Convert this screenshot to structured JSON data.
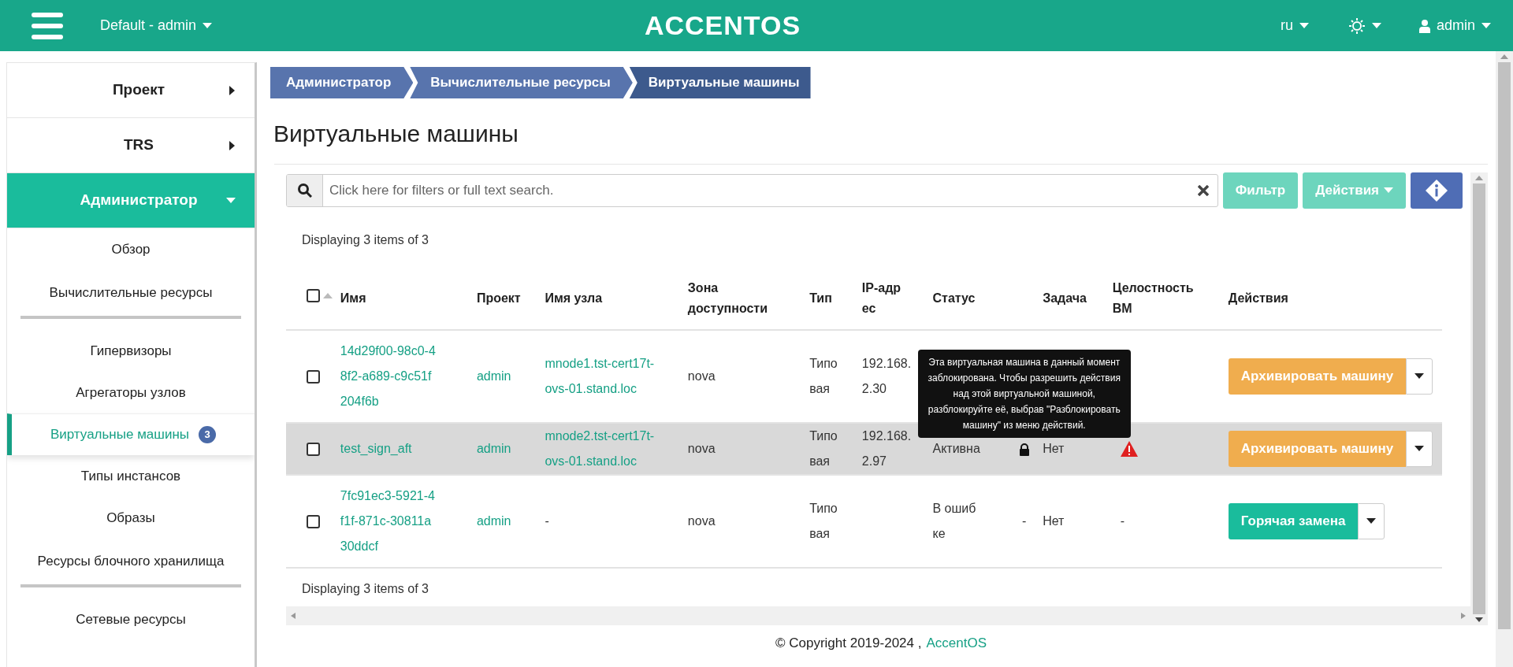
{
  "header": {
    "project_menu": "Default - admin",
    "logo": "ACCENTOS",
    "language": "ru",
    "user": "admin"
  },
  "sidebar": {
    "sections": [
      {
        "label": "Проект",
        "expanded": false
      },
      {
        "label": "TRS",
        "expanded": false
      },
      {
        "label": "Администратор",
        "expanded": true,
        "children": [
          {
            "label": "Обзор",
            "kind": "link",
            "selected": false
          },
          {
            "label": "Вычислительные ресурсы",
            "kind": "group"
          },
          {
            "label": "Гипервизоры",
            "kind": "link",
            "selected": false
          },
          {
            "label": "Агрегаторы узлов",
            "kind": "link",
            "selected": false
          },
          {
            "label": "Виртуальные машины",
            "kind": "link",
            "selected": true,
            "badge": "3"
          },
          {
            "label": "Типы инстансов",
            "kind": "link",
            "selected": false
          },
          {
            "label": "Образы",
            "kind": "link",
            "selected": false
          },
          {
            "label": "Ресурсы блочного хранилища",
            "kind": "group"
          },
          {
            "label": "Сетевые ресурсы",
            "kind": "link",
            "selected": false
          }
        ]
      }
    ]
  },
  "breadcrumb": [
    "Администратор",
    "Вычислительные ресурсы",
    "Виртуальные машины"
  ],
  "title": "Виртуальные машины",
  "search": {
    "placeholder": "Click here for filters or full text search."
  },
  "toolbar": {
    "filter": "Фильтр",
    "actions": "Действия"
  },
  "summary_top": "Displaying 3 items of 3",
  "table": {
    "select_all_checked": false,
    "columns": [
      "Имя",
      "Проект",
      "Имя узла",
      "Зона доступности",
      "Тип",
      "IP-адрес",
      "Статус",
      "",
      "Задача",
      "Целостность ВМ",
      "Действия"
    ],
    "rows": [
      {
        "checked": false,
        "hovered": false,
        "name": "14d29f00-98c0-48f2-a689-c9c51f204f6b",
        "project": "admin",
        "node": {
          "kind": "link",
          "text": "mnode1.tst-cert17t-ovs-01.stand.loc"
        },
        "zone": "nova",
        "type": "Типовая",
        "ip": "192.168.2.30",
        "action": {
          "label": "Архивировать машину",
          "kind": "warning"
        }
      },
      {
        "checked": false,
        "hovered": true,
        "name": "test_sign_aft",
        "project": "admin",
        "node": {
          "kind": "link",
          "text": "mnode2.tst-cert17t-ovs-01.stand.loc"
        },
        "zone": "nova",
        "type": "Типовая",
        "ip": "192.168.2.97",
        "status": "Активна",
        "lock": {
          "kind": "icon"
        },
        "task": "Нет",
        "integrity": {
          "kind": "warning"
        },
        "tooltip": "Эта виртуальная машина в данный момент заблокирована. Чтобы разрешить действия над этой виртуальной машиной, разблокируйте её, выбрав \"Разблокировать машину\" из меню действий.",
        "action": {
          "label": "Архивировать машину",
          "kind": "warning"
        }
      },
      {
        "checked": false,
        "hovered": false,
        "name": "7fc91ec3-5921-4f1f-871c-30811a30ddcf",
        "project": "admin",
        "node": {
          "kind": "text",
          "text": "-"
        },
        "zone": "nova",
        "type": "Типовая",
        "status": "В ошибке",
        "lock": {
          "kind": "text",
          "text": "-"
        },
        "task": "Нет",
        "integrity": {
          "kind": "text",
          "text": "-"
        },
        "action": {
          "label": "Горячая замена",
          "kind": "primary"
        }
      }
    ]
  },
  "summary_bottom": "Displaying 3 items of 3",
  "footer": {
    "copyright": "© Copyright 2019-2024 ,",
    "link": "AccentOS"
  }
}
